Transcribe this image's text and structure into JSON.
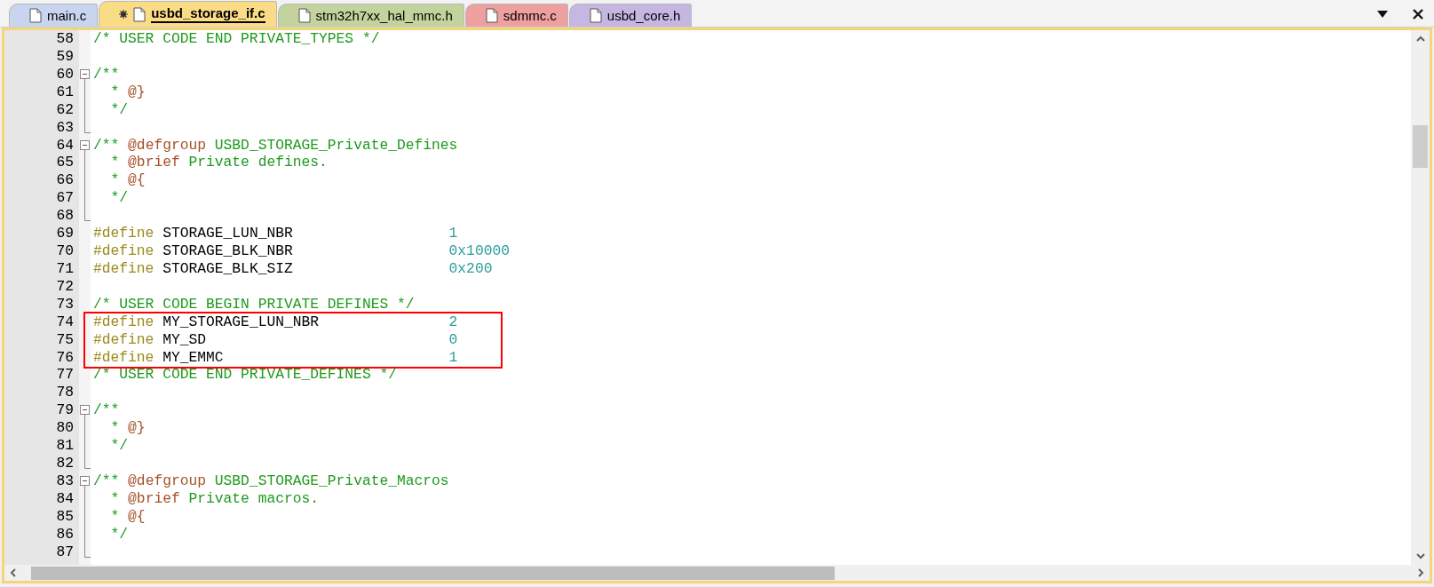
{
  "tabs": [
    {
      "label": "main.c",
      "selected": false,
      "modified": false,
      "color": "#c9d5ef"
    },
    {
      "label": "usbd_storage_if.c",
      "selected": true,
      "modified": true,
      "color": "#fbdc86"
    },
    {
      "label": "stm32h7xx_hal_mmc.h",
      "selected": false,
      "modified": false,
      "color": "#c3d39d"
    },
    {
      "label": "sdmmc.c",
      "selected": false,
      "modified": false,
      "color": "#ee9f9f"
    },
    {
      "label": "usbd_core.h",
      "selected": false,
      "modified": false,
      "color": "#c6b6e2"
    }
  ],
  "lines": [
    {
      "number": "58",
      "kind": "code",
      "segments": [
        {
          "kind": "comment",
          "text": "/* USER CODE END PRIVATE_TYPES */"
        }
      ]
    },
    {
      "number": "59",
      "kind": "code"
    },
    {
      "number": "60",
      "kind": "code",
      "gutter": {
        "kind": "open"
      },
      "segments": [
        {
          "kind": "comment",
          "text": "/**"
        }
      ]
    },
    {
      "number": "61",
      "kind": "code",
      "gutter": {
        "kind": "line"
      },
      "segments": [
        {
          "kind": "comment",
          "text": "  * "
        },
        {
          "kind": "tag",
          "text": "@}"
        }
      ]
    },
    {
      "number": "62",
      "kind": "code",
      "gutter": {
        "kind": "line"
      },
      "segments": [
        {
          "kind": "comment",
          "text": "  */"
        }
      ]
    },
    {
      "number": "63",
      "kind": "code",
      "gutter": {
        "kind": "end"
      }
    },
    {
      "number": "64",
      "kind": "code",
      "gutter": {
        "kind": "open"
      },
      "segments": [
        {
          "kind": "comment",
          "text": "/** "
        },
        {
          "kind": "tag",
          "text": "@defgroup"
        },
        {
          "kind": "comment",
          "text": " USBD_STORAGE_Private_Defines"
        }
      ]
    },
    {
      "number": "65",
      "kind": "code",
      "gutter": {
        "kind": "line"
      },
      "segments": [
        {
          "kind": "comment",
          "text": "  * "
        },
        {
          "kind": "tag",
          "text": "@brief"
        },
        {
          "kind": "comment",
          "text": " Private defines."
        }
      ]
    },
    {
      "number": "66",
      "kind": "code",
      "gutter": {
        "kind": "line"
      },
      "segments": [
        {
          "kind": "comment",
          "text": "  * "
        },
        {
          "kind": "tag",
          "text": "@{"
        }
      ]
    },
    {
      "number": "67",
      "kind": "code",
      "gutter": {
        "kind": "line"
      },
      "segments": [
        {
          "kind": "comment",
          "text": "  */"
        }
      ]
    },
    {
      "number": "68",
      "kind": "code",
      "gutter": {
        "kind": "end"
      }
    },
    {
      "number": "69",
      "kind": "define",
      "keyword": "#define",
      "name": "STORAGE_LUN_NBR",
      "value": "1",
      "boxed": false
    },
    {
      "number": "70",
      "kind": "define",
      "keyword": "#define",
      "name": "STORAGE_BLK_NBR",
      "value": "0x10000",
      "boxed": false
    },
    {
      "number": "71",
      "kind": "define",
      "keyword": "#define",
      "name": "STORAGE_BLK_SIZ",
      "value": "0x200",
      "boxed": false
    },
    {
      "number": "72",
      "kind": "code"
    },
    {
      "number": "73",
      "kind": "code",
      "segments": [
        {
          "kind": "comment",
          "text": "/* USER CODE BEGIN PRIVATE DEFINES */"
        }
      ]
    },
    {
      "number": "74",
      "kind": "define",
      "keyword": "#define",
      "name": "MY_STORAGE_LUN_NBR",
      "value": "2",
      "boxed": true
    },
    {
      "number": "75",
      "kind": "define",
      "keyword": "#define",
      "name": "MY_SD",
      "value": "0",
      "boxed": true
    },
    {
      "number": "76",
      "kind": "define",
      "keyword": "#define",
      "name": "MY_EMMC",
      "value": "1",
      "boxed": true
    },
    {
      "number": "77",
      "kind": "code",
      "segments": [
        {
          "kind": "comment",
          "text": "/* USER CODE END PRIVATE_DEFINES */"
        }
      ]
    },
    {
      "number": "78",
      "kind": "code"
    },
    {
      "number": "79",
      "kind": "code",
      "gutter": {
        "kind": "open"
      },
      "segments": [
        {
          "kind": "comment",
          "text": "/**"
        }
      ]
    },
    {
      "number": "80",
      "kind": "code",
      "gutter": {
        "kind": "line"
      },
      "segments": [
        {
          "kind": "comment",
          "text": "  * "
        },
        {
          "kind": "tag",
          "text": "@}"
        }
      ]
    },
    {
      "number": "81",
      "kind": "code",
      "gutter": {
        "kind": "line"
      },
      "segments": [
        {
          "kind": "comment",
          "text": "  */"
        }
      ]
    },
    {
      "number": "82",
      "kind": "code",
      "gutter": {
        "kind": "end"
      }
    },
    {
      "number": "83",
      "kind": "code",
      "gutter": {
        "kind": "open"
      },
      "segments": [
        {
          "kind": "comment",
          "text": "/** "
        },
        {
          "kind": "tag",
          "text": "@defgroup"
        },
        {
          "kind": "comment",
          "text": " USBD_STORAGE_Private_Macros"
        }
      ]
    },
    {
      "number": "84",
      "kind": "code",
      "gutter": {
        "kind": "line"
      },
      "segments": [
        {
          "kind": "comment",
          "text": "  * "
        },
        {
          "kind": "tag",
          "text": "@brief"
        },
        {
          "kind": "comment",
          "text": " Private macros."
        }
      ]
    },
    {
      "number": "85",
      "kind": "code",
      "gutter": {
        "kind": "line"
      },
      "segments": [
        {
          "kind": "comment",
          "text": "  * "
        },
        {
          "kind": "tag",
          "text": "@{"
        }
      ]
    },
    {
      "number": "86",
      "kind": "code",
      "gutter": {
        "kind": "line"
      },
      "segments": [
        {
          "kind": "comment",
          "text": "  */"
        }
      ]
    },
    {
      "number": "87",
      "kind": "code",
      "gutter": {
        "kind": "end"
      }
    }
  ]
}
